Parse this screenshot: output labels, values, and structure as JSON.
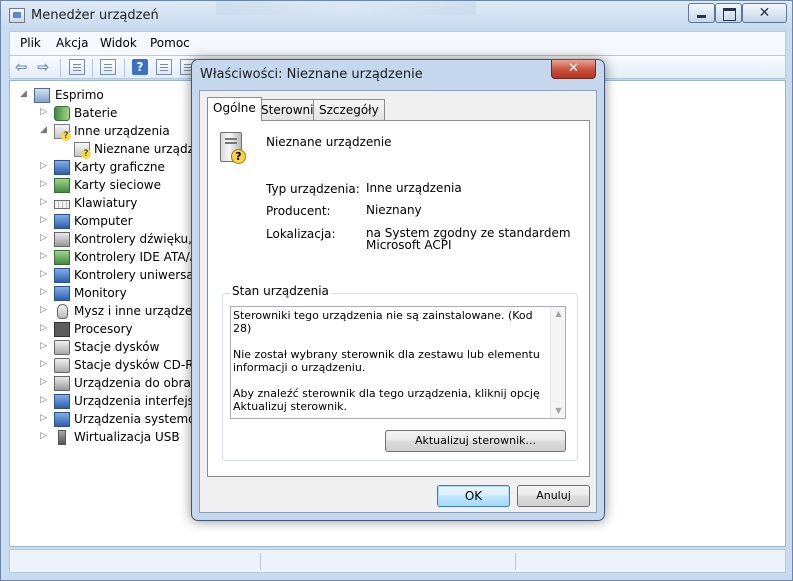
{
  "main_window": {
    "title": "Menedżer urządzeń"
  },
  "menubar": {
    "items": [
      "Plik",
      "Akcja",
      "Widok",
      "Pomoc"
    ]
  },
  "tree": {
    "root": "Esprimo",
    "items": [
      {
        "label": "Baterie",
        "icon": "battery-icon"
      },
      {
        "label": "Inne urządzenia",
        "icon": "unknown-device-icon",
        "expanded": true
      },
      {
        "label": "Nieznane urządzenie",
        "icon": "unknown-device-icon",
        "child": true
      },
      {
        "label": "Karty graficzne",
        "icon": "display-adapter-icon"
      },
      {
        "label": "Karty sieciowe",
        "icon": "network-adapter-icon"
      },
      {
        "label": "Klawiatury",
        "icon": "keyboard-icon"
      },
      {
        "label": "Komputer",
        "icon": "computer-icon"
      },
      {
        "label": "Kontrolery dźwięku, wi",
        "icon": "speaker-icon"
      },
      {
        "label": "Kontrolery IDE ATA/AT",
        "icon": "ide-controller-icon"
      },
      {
        "label": "Kontrolery uniwersalne",
        "icon": "usb-controller-icon"
      },
      {
        "label": "Monitory",
        "icon": "monitor-icon"
      },
      {
        "label": "Mysz i inne urządzenia",
        "icon": "mouse-icon"
      },
      {
        "label": "Procesory",
        "icon": "processor-icon"
      },
      {
        "label": "Stacje dysków",
        "icon": "disk-drive-icon"
      },
      {
        "label": "Stacje dysków CD-ROM",
        "icon": "cdrom-icon"
      },
      {
        "label": "Urządzenia do obrazov",
        "icon": "imaging-device-icon"
      },
      {
        "label": "Urządzenia interfejsu H",
        "icon": "hid-icon"
      },
      {
        "label": "Urządzenia systemowe",
        "icon": "system-device-icon"
      },
      {
        "label": "Wirtualizacja USB",
        "icon": "usb-icon"
      }
    ]
  },
  "dialog": {
    "title": "Właściwości: Nieznane urządzenie",
    "close_glyph": "✕",
    "tabs": [
      "Ogólne",
      "Sterownik",
      "Szczegóły"
    ],
    "active_tab": "Ogólne",
    "device_name": "Nieznane urządzenie",
    "properties": [
      {
        "label": "Typ urządzenia:",
        "value": "Inne urządzenia"
      },
      {
        "label": "Producent:",
        "value": "Nieznany"
      },
      {
        "label": "Lokalizacja:",
        "value": "na System zgodny ze standardem Microsoft ACPI"
      }
    ],
    "status_group_label": "Stan urządzenia",
    "status_lines": [
      "Sterowniki tego urządzenia nie są zainstalowane. (Kod 28)",
      "Nie został wybrany sterownik dla zestawu lub elementu informacji o urządzeniu.",
      "Aby znaleźć sterownik dla tego urządzenia, kliknij opcję Aktualizuj sterownik."
    ],
    "update_button": "Aktualizuj sterownik...",
    "ok_button": "OK",
    "cancel_button": "Anuluj"
  }
}
